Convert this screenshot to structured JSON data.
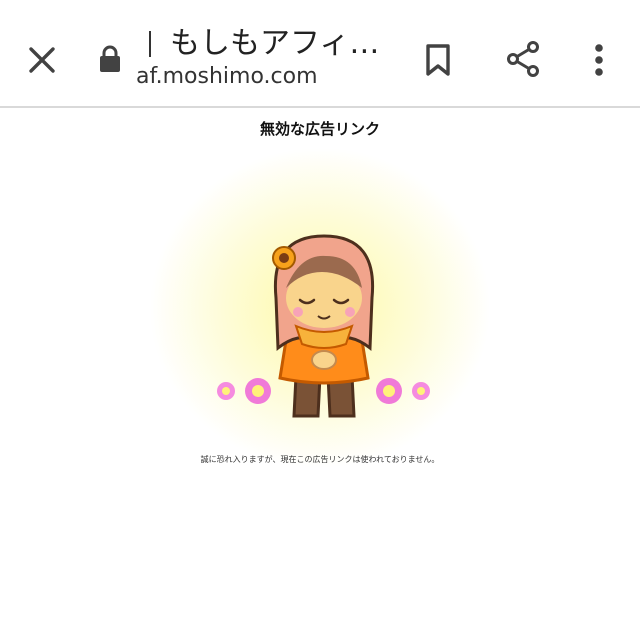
{
  "toolbar": {
    "title": "もしもアフィ…",
    "url": "af.moshimo.com",
    "icons": {
      "close": "close-icon",
      "lock": "lock-icon",
      "bookmark": "bookmark-icon",
      "share": "share-icon",
      "more": "more-vert-icon"
    }
  },
  "main": {
    "heading": "無効な広告リンク",
    "message": "誠に恐れ入りますが、現在この広告リンクは使われておりません。"
  },
  "colors": {
    "toolbar_icon": "#424242",
    "glow": "#fdf9a8",
    "hair": "#f1a48c",
    "dress": "#ff8c1a",
    "flower": "#f07ad8"
  }
}
